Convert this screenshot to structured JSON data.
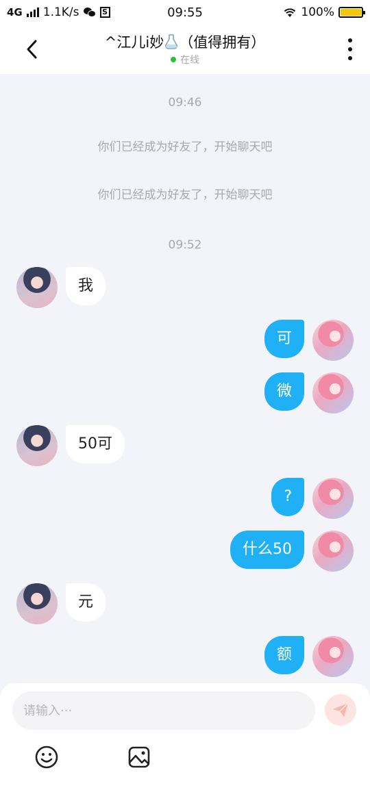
{
  "status_bar": {
    "network": "4G",
    "speed": "1.1K/s",
    "time": "09:55",
    "battery": "100%",
    "icons": [
      "signal-icon",
      "wechat-icon",
      "s-app-icon",
      "wifi-icon",
      "battery-icon"
    ]
  },
  "header": {
    "title": "^江儿i妙",
    "title_suffix": "（值得拥有）",
    "status": "在线",
    "status_color": "#22c33a"
  },
  "chat": {
    "time_1": "09:46",
    "system_1": "你们已经成为好友了，开始聊天吧",
    "system_2": "你们已经成为好友了，开始聊天吧",
    "time_2": "09:52",
    "messages": [
      {
        "from": "peer",
        "text": "我"
      },
      {
        "from": "self",
        "text": "可"
      },
      {
        "from": "self",
        "text": "微"
      },
      {
        "from": "peer",
        "text": "50可"
      },
      {
        "from": "self",
        "text": "?"
      },
      {
        "from": "self",
        "text": "什么50"
      },
      {
        "from": "peer",
        "text": "元"
      },
      {
        "from": "self",
        "text": "额"
      }
    ],
    "self_bubble_color": "#1fb0f6",
    "peer_bubble_color": "#ffffff"
  },
  "composer": {
    "placeholder": "请输入···",
    "value": "",
    "icons": [
      "send-icon",
      "emoji-icon",
      "image-icon"
    ]
  }
}
